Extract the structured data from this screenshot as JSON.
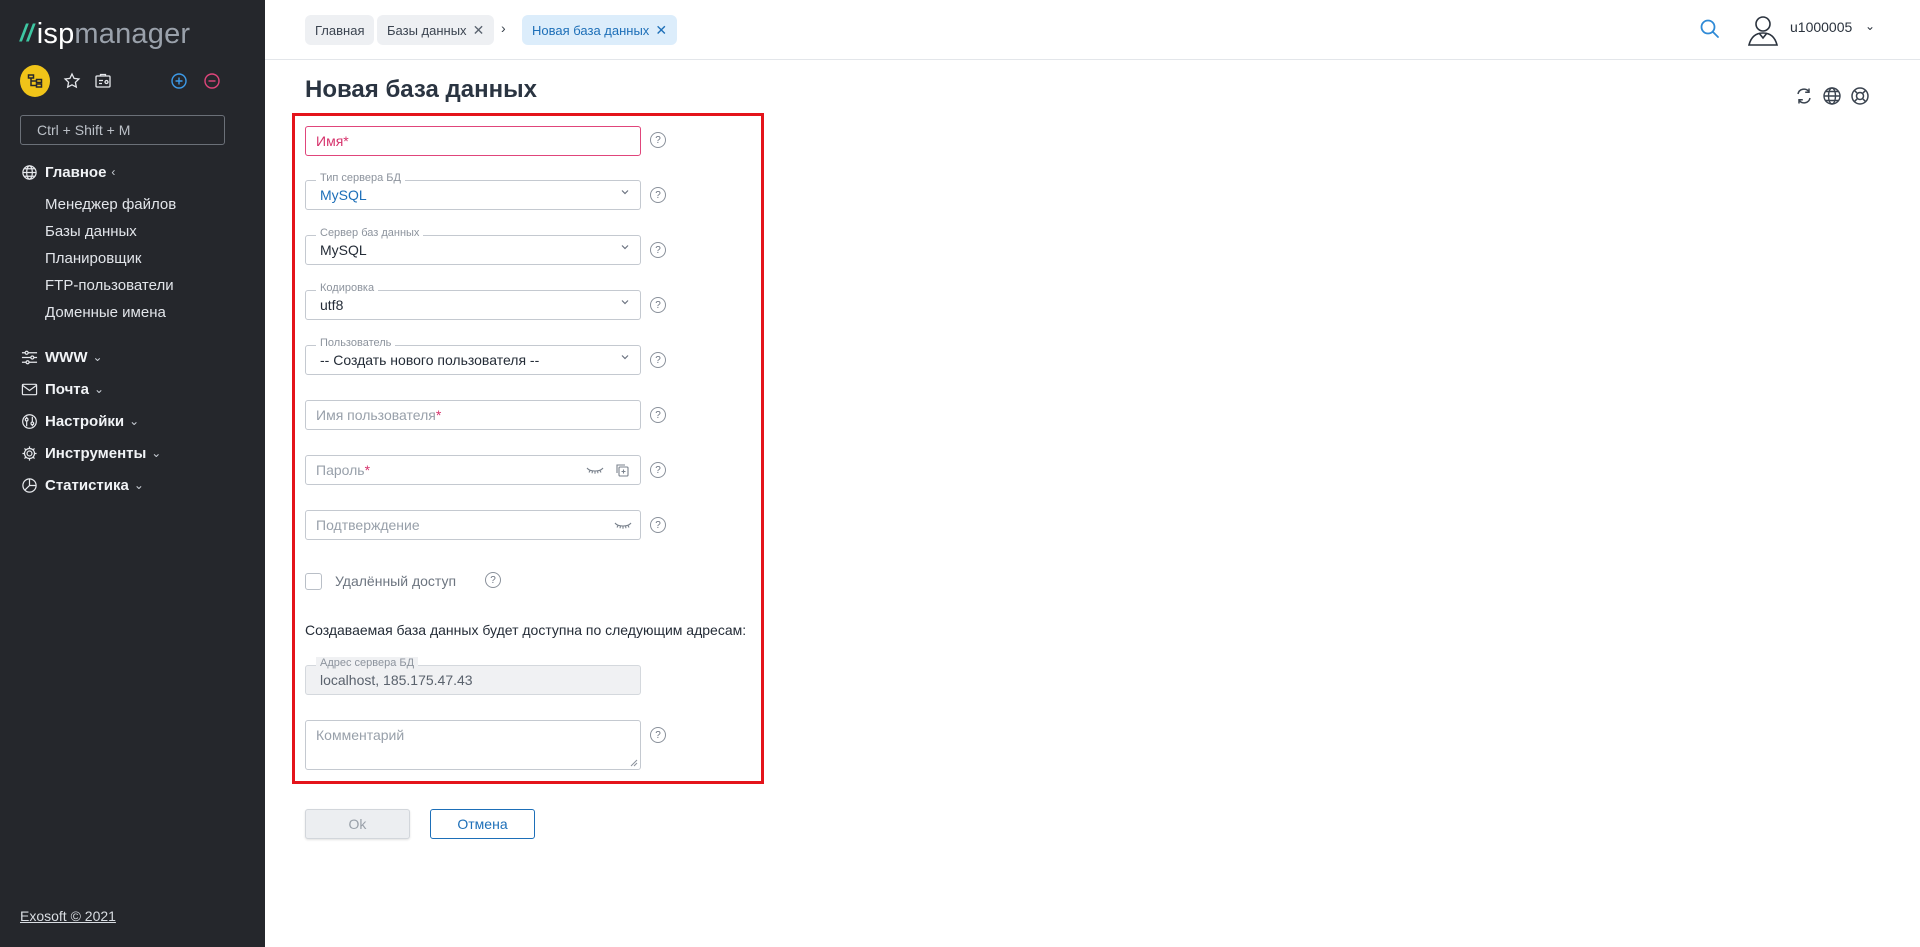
{
  "sidebar": {
    "logo": {
      "slash": "//",
      "isp": "isp",
      "manager": "manager"
    },
    "search": {
      "placeholder": "Ctrl + Shift + M"
    },
    "groups": [
      {
        "label": "Главное",
        "chevron": "‹",
        "icon": "globe-icon"
      },
      {
        "label": "WWW",
        "chevron": "⌄",
        "icon": "sliders-icon"
      },
      {
        "label": "Почта",
        "chevron": "⌄",
        "icon": "mail-icon"
      },
      {
        "label": "Настройки",
        "chevron": "⌄",
        "icon": "settings-icon"
      },
      {
        "label": "Инструменты",
        "chevron": "⌄",
        "icon": "gear-icon"
      },
      {
        "label": "Статистика",
        "chevron": "⌄",
        "icon": "pie-chart-icon"
      }
    ],
    "items": [
      {
        "label": "Менеджер файлов"
      },
      {
        "label": "Базы данных"
      },
      {
        "label": "Планировщик"
      },
      {
        "label": "FTP-пользователи"
      },
      {
        "label": "Доменные имена"
      }
    ],
    "footer": "Exosoft © 2021"
  },
  "topbar": {
    "breadcrumbs": [
      {
        "label": "Главная"
      },
      {
        "label": "Базы данных",
        "close": "✕"
      },
      {
        "label": "Новая база данных",
        "close": "✕"
      }
    ],
    "separator": "›",
    "user": {
      "name": "u1000005",
      "chevron": "⌄"
    }
  },
  "page": {
    "title": "Новая база данных",
    "form": {
      "name": {
        "placeholder": "Имя",
        "required": "*"
      },
      "db_type": {
        "label": "Тип сервера БД",
        "value": "MySQL"
      },
      "db_server": {
        "label": "Сервер баз данных",
        "value": "MySQL"
      },
      "charset": {
        "label": "Кодировка",
        "value": "utf8"
      },
      "user": {
        "label": "Пользователь",
        "value": "-- Создать нового пользователя --"
      },
      "username": {
        "placeholder": "Имя пользователя",
        "required": "*"
      },
      "password": {
        "placeholder": "Пароль",
        "required": "*"
      },
      "confirm": {
        "placeholder": "Подтверждение"
      },
      "remote_access": {
        "label": "Удалённый доступ",
        "checked": false
      },
      "info": "Создаваемая база данных будет доступна по следующим адресам:",
      "address": {
        "label": "Адрес сервера БД",
        "value": "localhost, 185.175.47.43"
      },
      "comment": {
        "placeholder": "Комментарий"
      }
    },
    "help": "?",
    "buttons": {
      "ok": "Ok",
      "cancel": "Отмена"
    }
  },
  "colors": {
    "sidebar_bg": "#25272c",
    "accent": "#1d6fb8",
    "highlight_frame": "#e4141b",
    "logo_accent": "#3ec7a2",
    "required": "#d6336c"
  }
}
